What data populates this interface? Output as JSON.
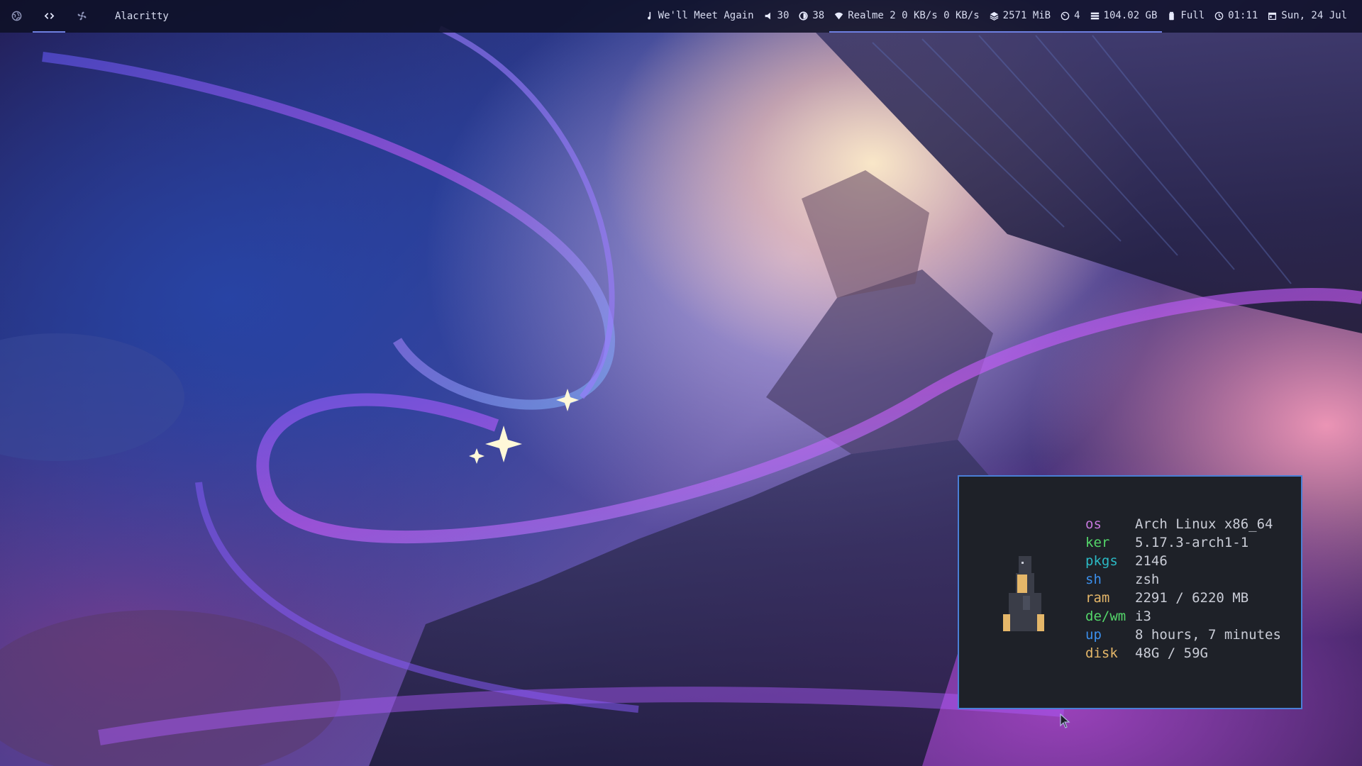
{
  "bar": {
    "workspaces": [
      {
        "icon": "globe-icon",
        "active": false
      },
      {
        "icon": "code-icon",
        "active": true
      },
      {
        "icon": "fan-icon",
        "active": false
      }
    ],
    "window_title": "Alacritty",
    "modules": {
      "music": {
        "icon": "music-note-icon",
        "text": "We'll Meet Again"
      },
      "volume": {
        "icon": "speaker-icon",
        "text": "30"
      },
      "brightness": {
        "icon": "brightness-icon",
        "text": "38"
      },
      "network": {
        "icon": "wifi-icon",
        "text": "Realme 2 0 KB/s 0 KB/s"
      },
      "memory": {
        "icon": "layers-icon",
        "text": "2571 MiB"
      },
      "cpu": {
        "icon": "gauge-icon",
        "text": "4"
      },
      "disk": {
        "icon": "storage-icon",
        "text": "104.02 GB"
      },
      "battery": {
        "icon": "battery-icon",
        "text": "Full"
      },
      "time": {
        "icon": "clock-icon",
        "text": "01:11"
      },
      "date": {
        "icon": "calendar-icon",
        "text": "Sun, 24 Jul"
      }
    },
    "colors": {
      "accent": "#6d7fe0",
      "bar_bg": "#0e1026"
    }
  },
  "terminal": {
    "rows": [
      {
        "key": "os",
        "value": "Arch Linux x86_64",
        "color": "#c678dd"
      },
      {
        "key": "ker",
        "value": "5.17.3-arch1-1",
        "color": "#54d66a"
      },
      {
        "key": "pkgs",
        "value": "2146",
        "color": "#2bbac5"
      },
      {
        "key": "sh",
        "value": "zsh",
        "color": "#3b8eea"
      },
      {
        "key": "ram",
        "value": "2291 / 6220 MB",
        "color": "#e5b769"
      },
      {
        "key": "de/wm",
        "value": "i3",
        "color": "#54d66a"
      },
      {
        "key": "up",
        "value": "8 hours, 7 minutes",
        "color": "#3b8eea"
      },
      {
        "key": "disk",
        "value": "48G / 59G",
        "color": "#e5b769"
      }
    ],
    "colors": {
      "border": "#4a7fd6",
      "background": "#1e2128"
    }
  }
}
